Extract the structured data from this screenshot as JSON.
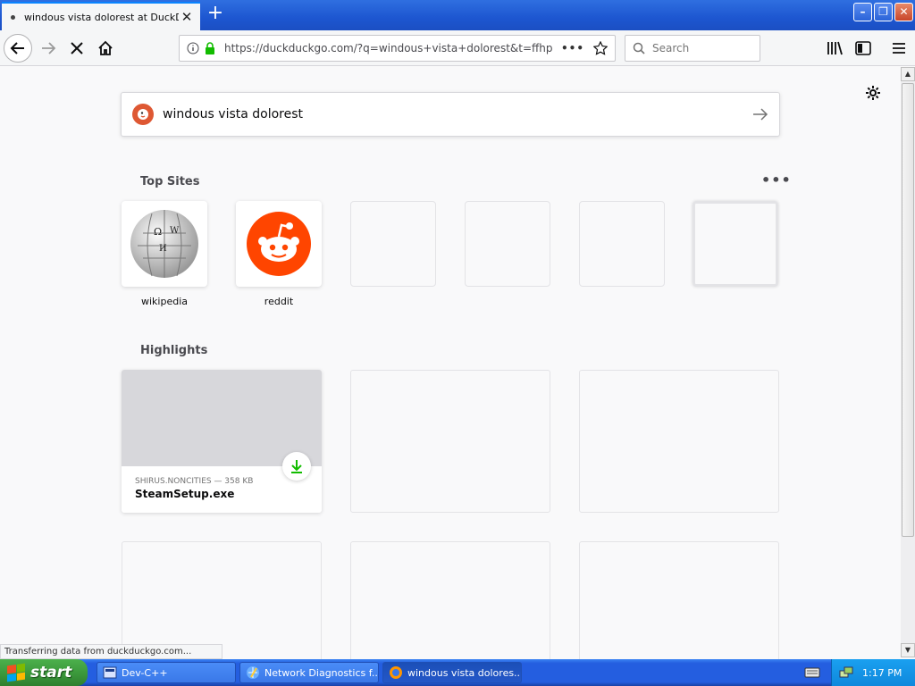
{
  "browser": {
    "tab": {
      "title": "windous vista dolorest at DuckDuckGo"
    },
    "url": "https://duckduckgo.com/?q=windous+vista+dolorest&t=ffhp",
    "search_placeholder": "Search",
    "status_text": "Transferring data from duckduckgo.com..."
  },
  "newtab": {
    "search_query": "windous vista dolorest",
    "top_sites_title": "Top Sites",
    "top_sites": [
      {
        "label": "wikipedia",
        "icon": "wikipedia-globe-icon"
      },
      {
        "label": "reddit",
        "icon": "reddit-alien-icon"
      }
    ],
    "highlights_title": "Highlights",
    "highlight": {
      "meta": "SHIRUS.NONCITIES — 358 KB",
      "name": "SteamSetup.exe",
      "icon": "download-icon"
    }
  },
  "taskbar": {
    "start_label": "start",
    "tasks": [
      {
        "label": "Dev-C++"
      },
      {
        "label": "Network Diagnostics f..."
      },
      {
        "label": "windous vista dolores..."
      }
    ],
    "clock": "1:17 PM"
  },
  "colors": {
    "titlebar": "#2f6fe0",
    "accent": "#0a84ff",
    "lock_green": "#12bc00",
    "reddit": "#ff4500",
    "ddg": "#de5833",
    "download_green": "#12bc00",
    "xp_start": "#3c9a3c"
  }
}
